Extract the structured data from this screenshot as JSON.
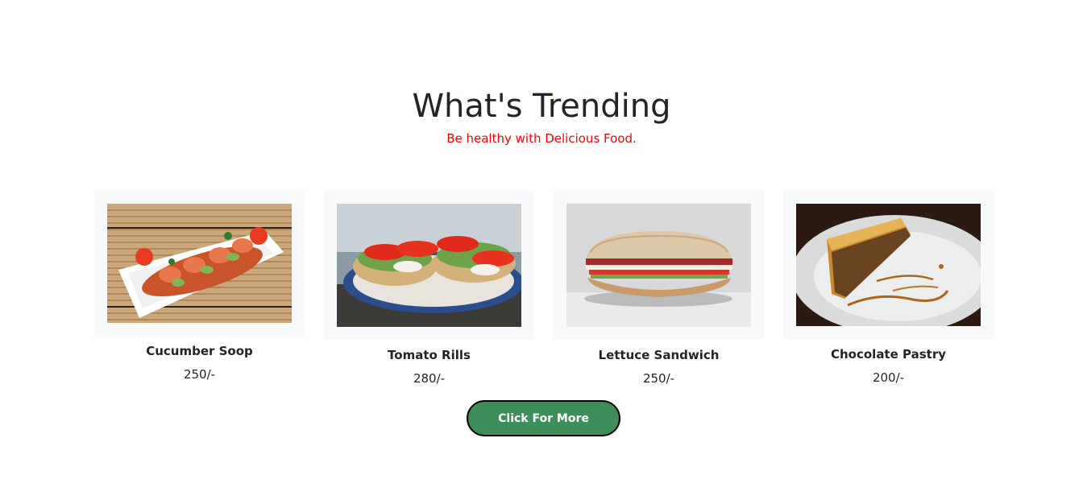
{
  "section": {
    "title": "What's Trending",
    "subtitle": "Be healthy with Delicious Food.",
    "subtitle_color": "#ff0000"
  },
  "items": [
    {
      "name": "Cucumber Soop",
      "price": "250/-",
      "image": "shrimp-cucumber-dish-photo"
    },
    {
      "name": "Tomato Rills",
      "price": "280/-",
      "image": "tomato-bruschetta-photo"
    },
    {
      "name": "Lettuce Sandwich",
      "price": "250/-",
      "image": "sandwich-photo"
    },
    {
      "name": "Chocolate Pastry",
      "price": "200/-",
      "image": "baklava-pastry-photo"
    }
  ],
  "cta": {
    "label": "Click For More",
    "background": "#3e8e5a"
  }
}
